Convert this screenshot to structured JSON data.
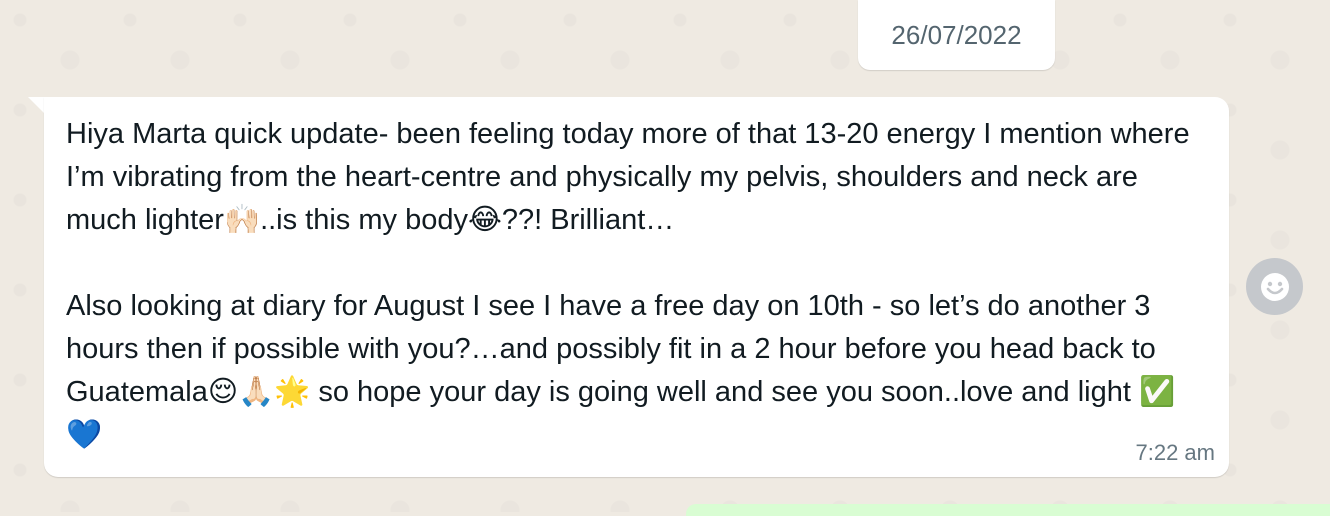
{
  "chat": {
    "date_chip": "26/07/2022",
    "message": {
      "paragraph1": "Hiya Marta quick update- been feeling today more of that 13-20 energy I mention where I’m vibrating from the heart-centre and physically my pelvis, shoulders and neck are much lighter🙌🏻..is this my body😂??! Brilliant…",
      "paragraph2": "Also looking at diary for August I see I have a free day on 10th - so let’s do another 3 hours then if possible with you?…and possibly fit in a 2 hour before you head back to Guatemala😌🙏🏻🌟 so hope your day is going well and see you soon..love and light ✅💙",
      "time": "7:22 am"
    },
    "react_button": {
      "icon": "smiley-icon"
    }
  },
  "colors": {
    "wallpaper": "#efeae2",
    "incoming_bubble": "#ffffff",
    "outgoing_bubble": "#d9fdd3",
    "meta_text": "#667781"
  }
}
